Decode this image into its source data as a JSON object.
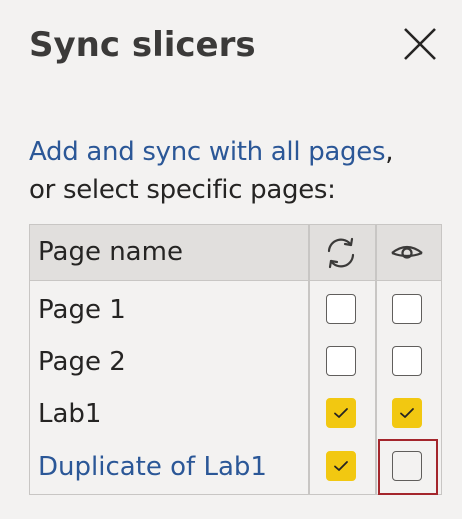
{
  "pane": {
    "title": "Sync slicers",
    "close_icon": "close-icon"
  },
  "description": {
    "link_text": "Add and sync with all pages",
    "comma": ",",
    "rest_text": "or select specific pages:"
  },
  "table": {
    "header": {
      "page_name_label": "Page name",
      "sync_icon": "sync-icon",
      "visible_icon": "eye-icon"
    },
    "rows": [
      {
        "label": "Page 1",
        "sync": false,
        "visible": false
      },
      {
        "label": "Page 2",
        "sync": false,
        "visible": false
      },
      {
        "label": "Lab1",
        "sync": true,
        "visible": true
      },
      {
        "label": "Duplicate of Lab1",
        "sync": true,
        "visible": false
      }
    ]
  },
  "colors": {
    "link": "#2b5797",
    "checked": "#f2c811",
    "focus_outline": "#a4262c"
  }
}
